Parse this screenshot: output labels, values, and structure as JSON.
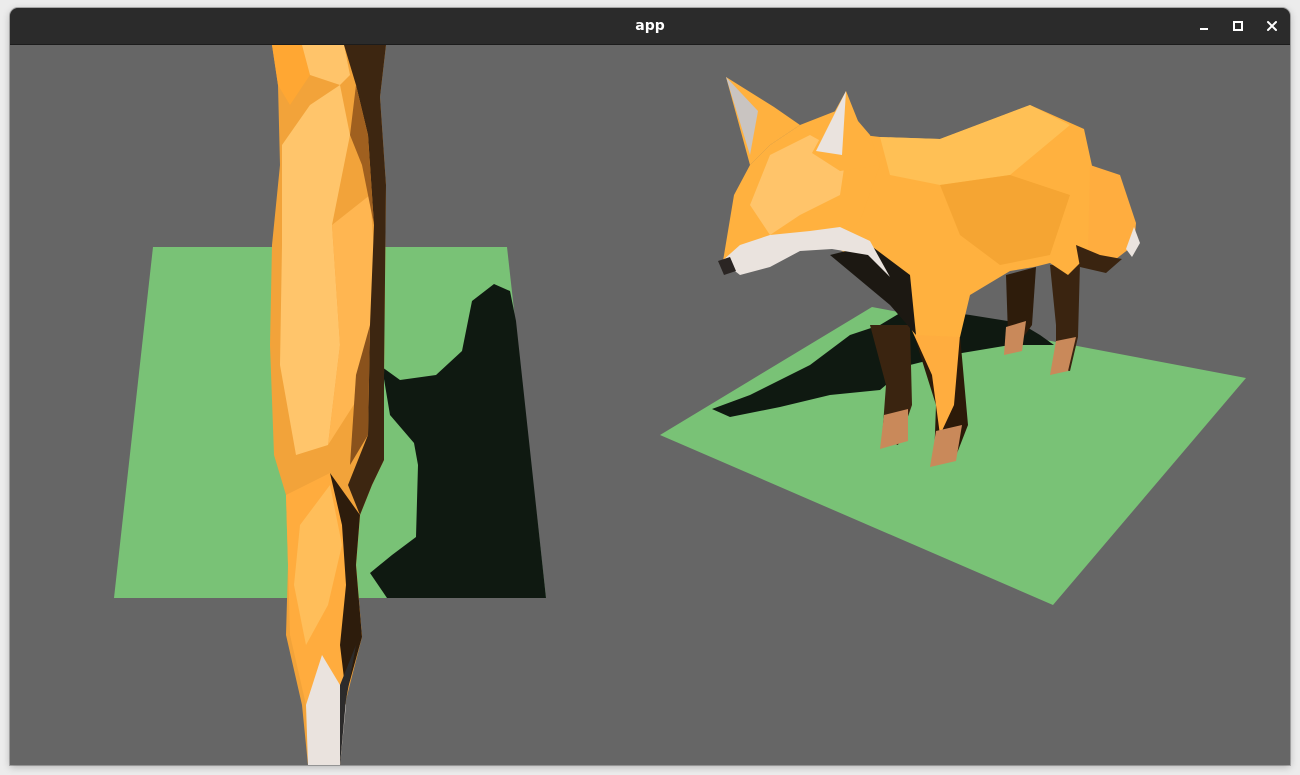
{
  "window": {
    "title": "app",
    "buttons": {
      "minimize": "minimize-icon",
      "maximize": "maximize-icon",
      "close": "close-icon"
    }
  },
  "scene": {
    "background_color": "#666666",
    "ground_color": "#79c276",
    "shadow_color": "#0f1911",
    "fox_orange": "#ffb03f",
    "fox_dark": "#3a2410",
    "fox_white": "#eae3de",
    "fox_paw": "#c9895a"
  }
}
